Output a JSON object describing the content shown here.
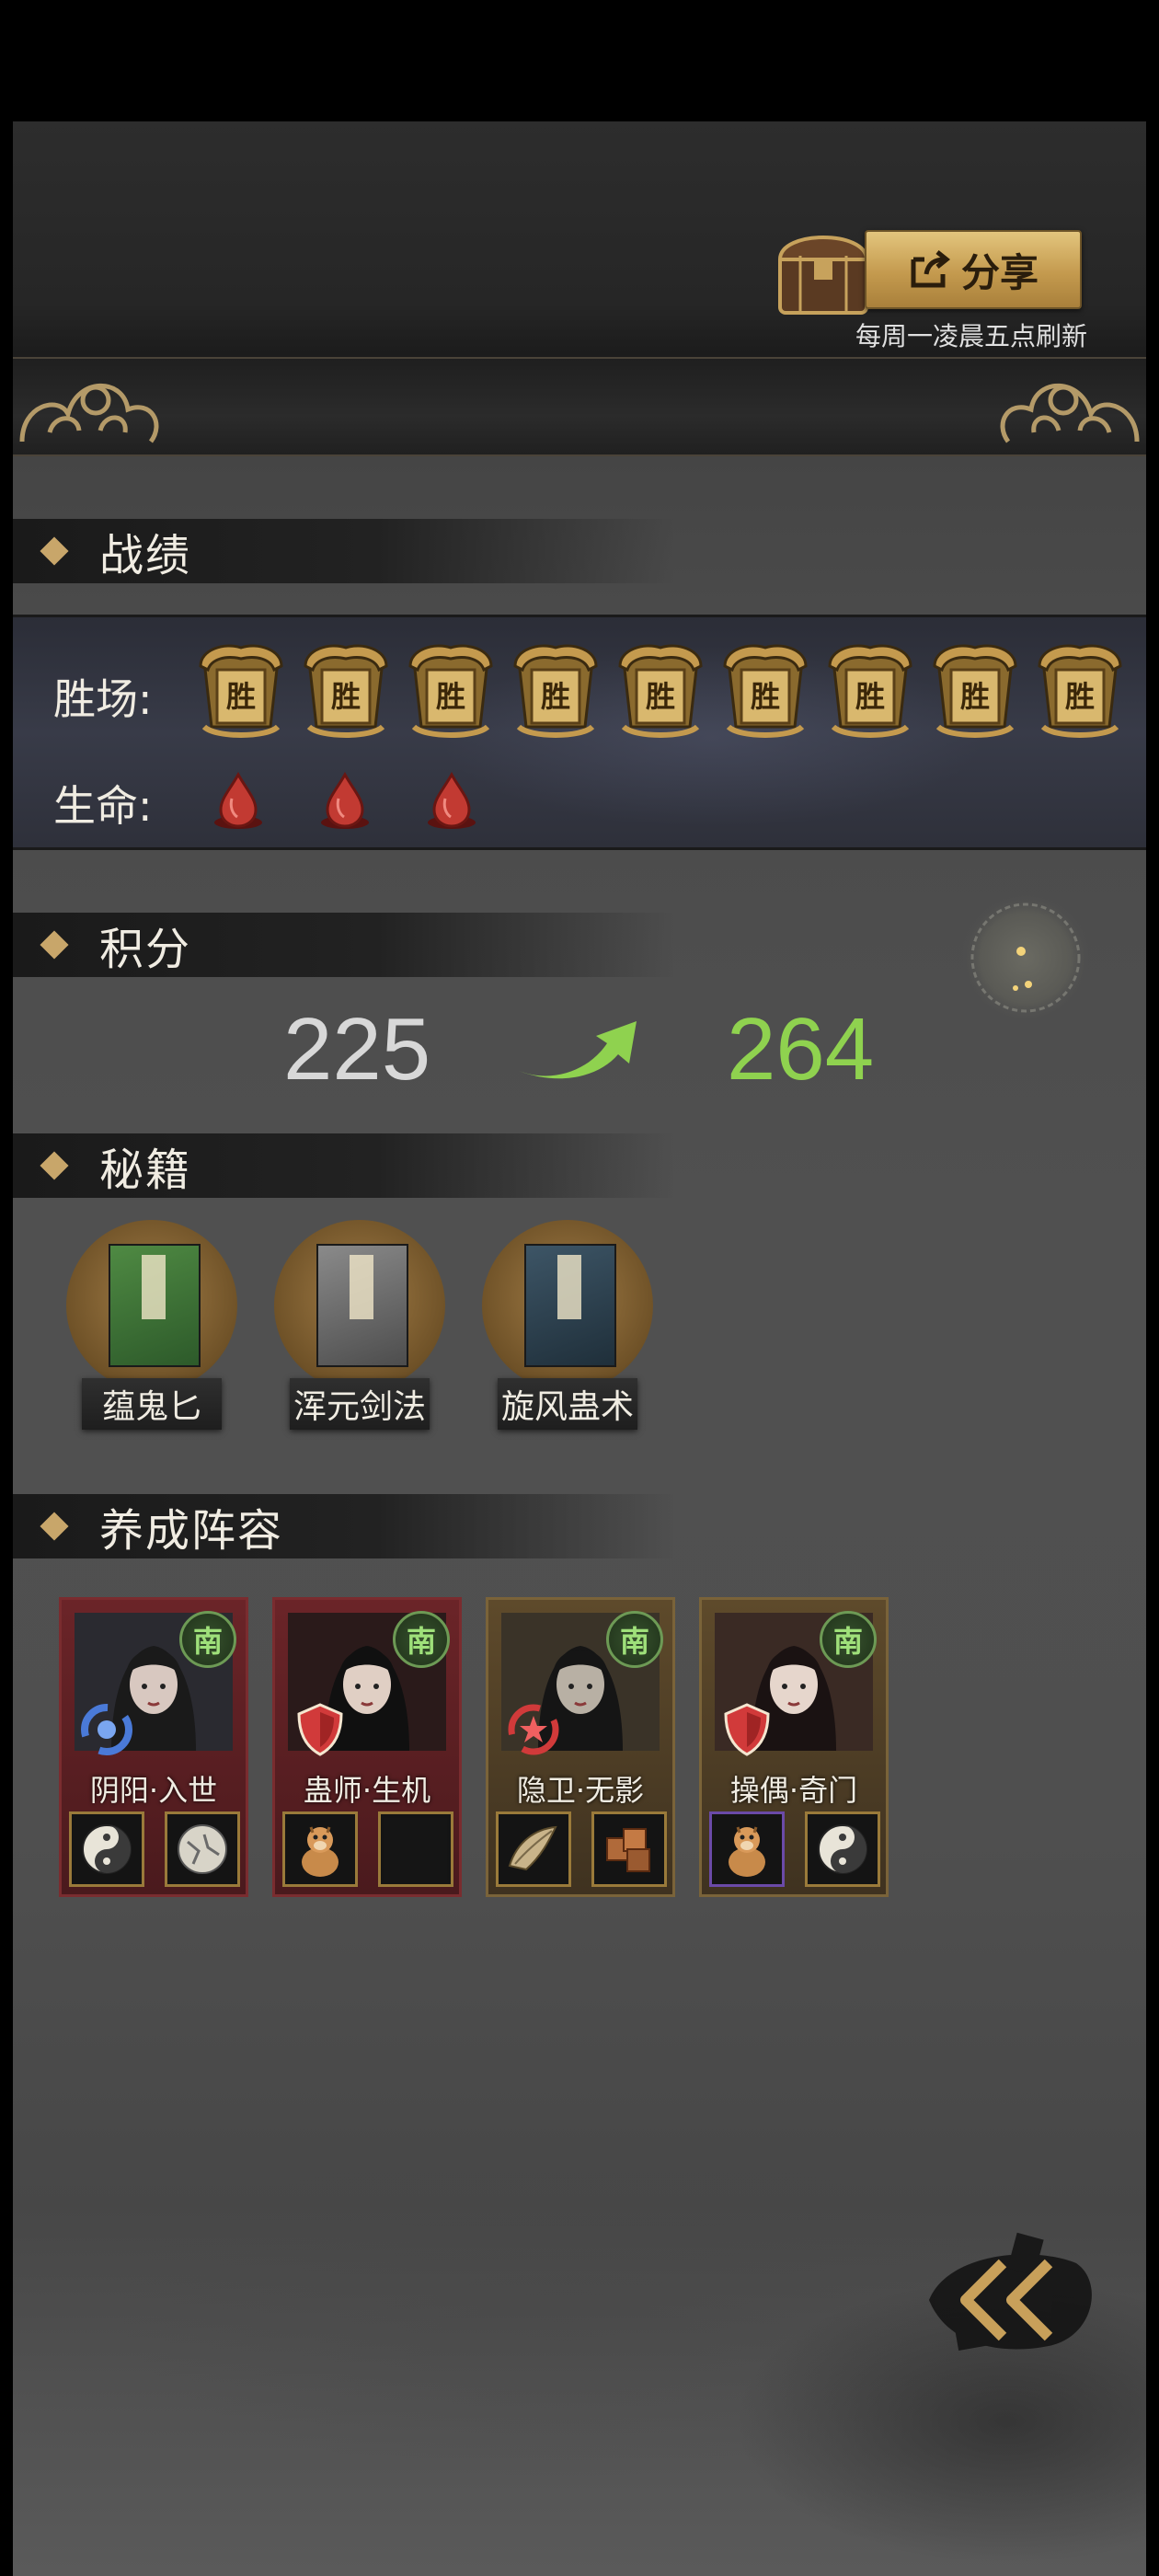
{
  "header": {
    "share_label": "分享",
    "refresh_note": "每周一凌晨五点刷新"
  },
  "record": {
    "section_title": "战绩",
    "wins_label": "胜场:",
    "wins_count": 9,
    "win_token_text": "胜",
    "lives_label": "生命:",
    "lives_count": 3
  },
  "score": {
    "section_title": "积分",
    "old": "225",
    "new": "264",
    "new_color": "#8fd24f"
  },
  "books": {
    "section_title": "秘籍",
    "items": [
      {
        "name": "蕴鬼匕",
        "cover": "green"
      },
      {
        "name": "浑元剑法",
        "cover": "gray"
      },
      {
        "name": "旋风蛊术",
        "cover": "blue"
      }
    ]
  },
  "lineup": {
    "section_title": "养成阵容",
    "heroes": [
      {
        "name": "阴阳·入世",
        "frame": "red",
        "faction": "南",
        "role_icon": "swirl-icon",
        "equip": [
          "yin-yang-icon",
          "stone-orb-icon"
        ]
      },
      {
        "name": "蛊师·生机",
        "frame": "red",
        "faction": "南",
        "role_icon": "shield-icon",
        "equip": [
          "alpaca-icon",
          "empty-slot"
        ]
      },
      {
        "name": "隐卫·无影",
        "frame": "gold",
        "faction": "南",
        "role_icon": "swirl-star-icon",
        "equip": [
          "horn-icon",
          "wood-puzzle-icon"
        ]
      },
      {
        "name": "操偶·奇门",
        "frame": "gold",
        "faction": "南",
        "role_icon": "shield-icon",
        "equip": [
          "alpaca-icon",
          "yin-yang-icon"
        ]
      }
    ]
  }
}
